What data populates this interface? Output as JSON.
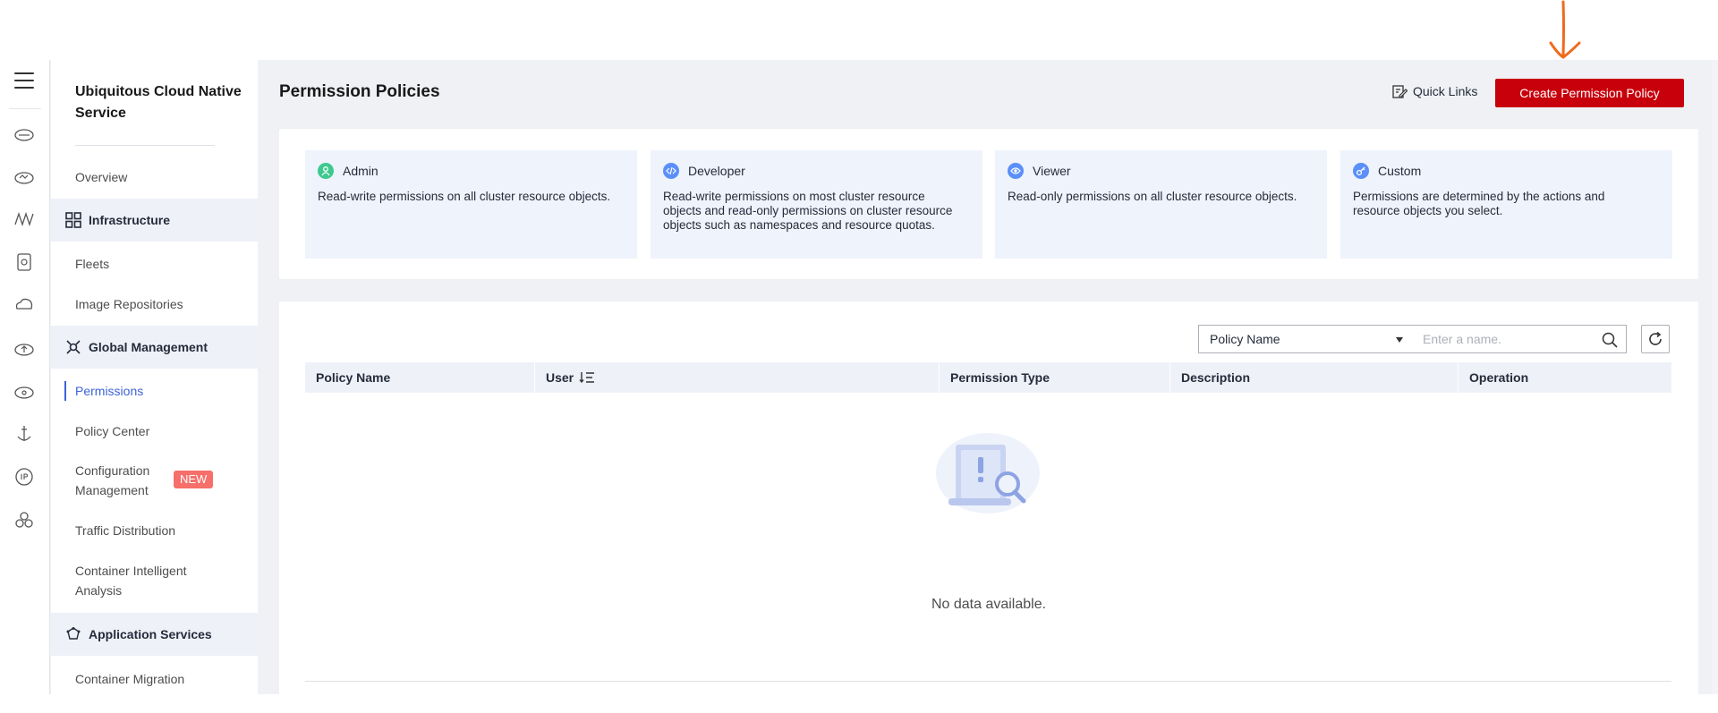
{
  "sidebar": {
    "title": "Ubiquitous Cloud Native Service",
    "items": {
      "overview": "Overview",
      "infrastructure": "Infrastructure",
      "fleets": "Fleets",
      "image_repositories": "Image Repositories",
      "global_management": "Global Management",
      "permissions": "Permissions",
      "policy_center": "Policy Center",
      "configuration_management": "Configuration Management",
      "new_badge": "NEW",
      "traffic_distribution": "Traffic Distribution",
      "container_intelligent_analysis": "Container Intelligent Analysis",
      "application_services": "Application Services",
      "container_migration": "Container Migration"
    }
  },
  "header": {
    "title": "Permission Policies",
    "quick_links": "Quick Links",
    "create_button": "Create Permission Policy"
  },
  "policy_types": [
    {
      "name": "Admin",
      "description": "Read-write permissions on all cluster resource objects.",
      "icon": "user-icon",
      "color": "#3ec98e"
    },
    {
      "name": "Developer",
      "description": "Read-write permissions on most cluster resource objects and read-only permissions on cluster resource objects such as namespaces and resource quotas.",
      "icon": "code-icon",
      "color": "#5b8ff9"
    },
    {
      "name": "Viewer",
      "description": "Read-only permissions on all cluster resource objects.",
      "icon": "eye-icon",
      "color": "#5b8ff9"
    },
    {
      "name": "Custom",
      "description": "Permissions are determined by the actions and resource objects you select.",
      "icon": "key-icon",
      "color": "#5b8ff9"
    }
  ],
  "filter": {
    "selected": "Policy Name",
    "search_placeholder": "Enter a name."
  },
  "table": {
    "columns": [
      "Policy Name",
      "User",
      "Permission Type",
      "Description",
      "Operation"
    ],
    "empty_text": "No data available."
  },
  "colors": {
    "primary_button": "#c7000b",
    "accent": "#3d63d9",
    "annotation_arrow": "#f06a1d"
  }
}
